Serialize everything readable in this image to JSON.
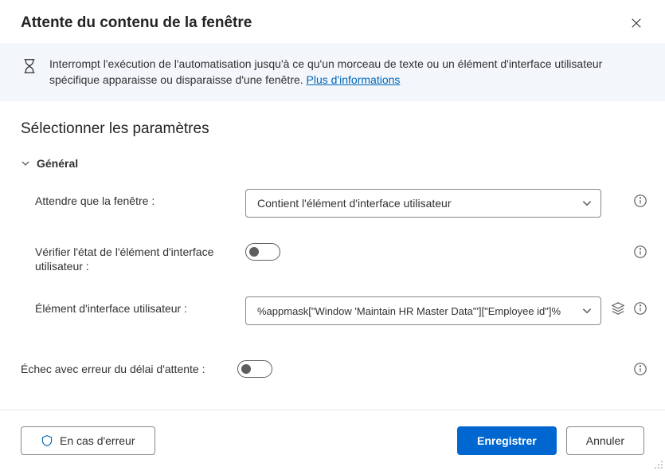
{
  "dialog": {
    "title": "Attente du contenu de la fenêtre"
  },
  "banner": {
    "text": "Interrompt l'exécution de l'automatisation jusqu'à ce qu'un morceau de texte ou un élément d'interface utilisateur spécifique apparaisse ou disparaisse d'une fenêtre. ",
    "link_text": "Plus d'informations"
  },
  "section": {
    "title": "Sélectionner les paramètres"
  },
  "group": {
    "general": "Général"
  },
  "fields": {
    "wait_window_label": "Attendre que la fenêtre :",
    "wait_window_value": "Contient l'élément d'interface utilisateur",
    "check_state_label": "Vérifier l'état de l'élément d'interface utilisateur :",
    "ui_element_label": "Élément d'interface utilisateur :",
    "ui_element_value": "%appmask[\"Window 'Maintain HR Master Data'\"][\"Employee id\"]%",
    "timeout_error_label": "Échec avec erreur du délai d'attente :"
  },
  "footer": {
    "on_error": "En cas d'erreur",
    "save": "Enregistrer",
    "cancel": "Annuler"
  }
}
